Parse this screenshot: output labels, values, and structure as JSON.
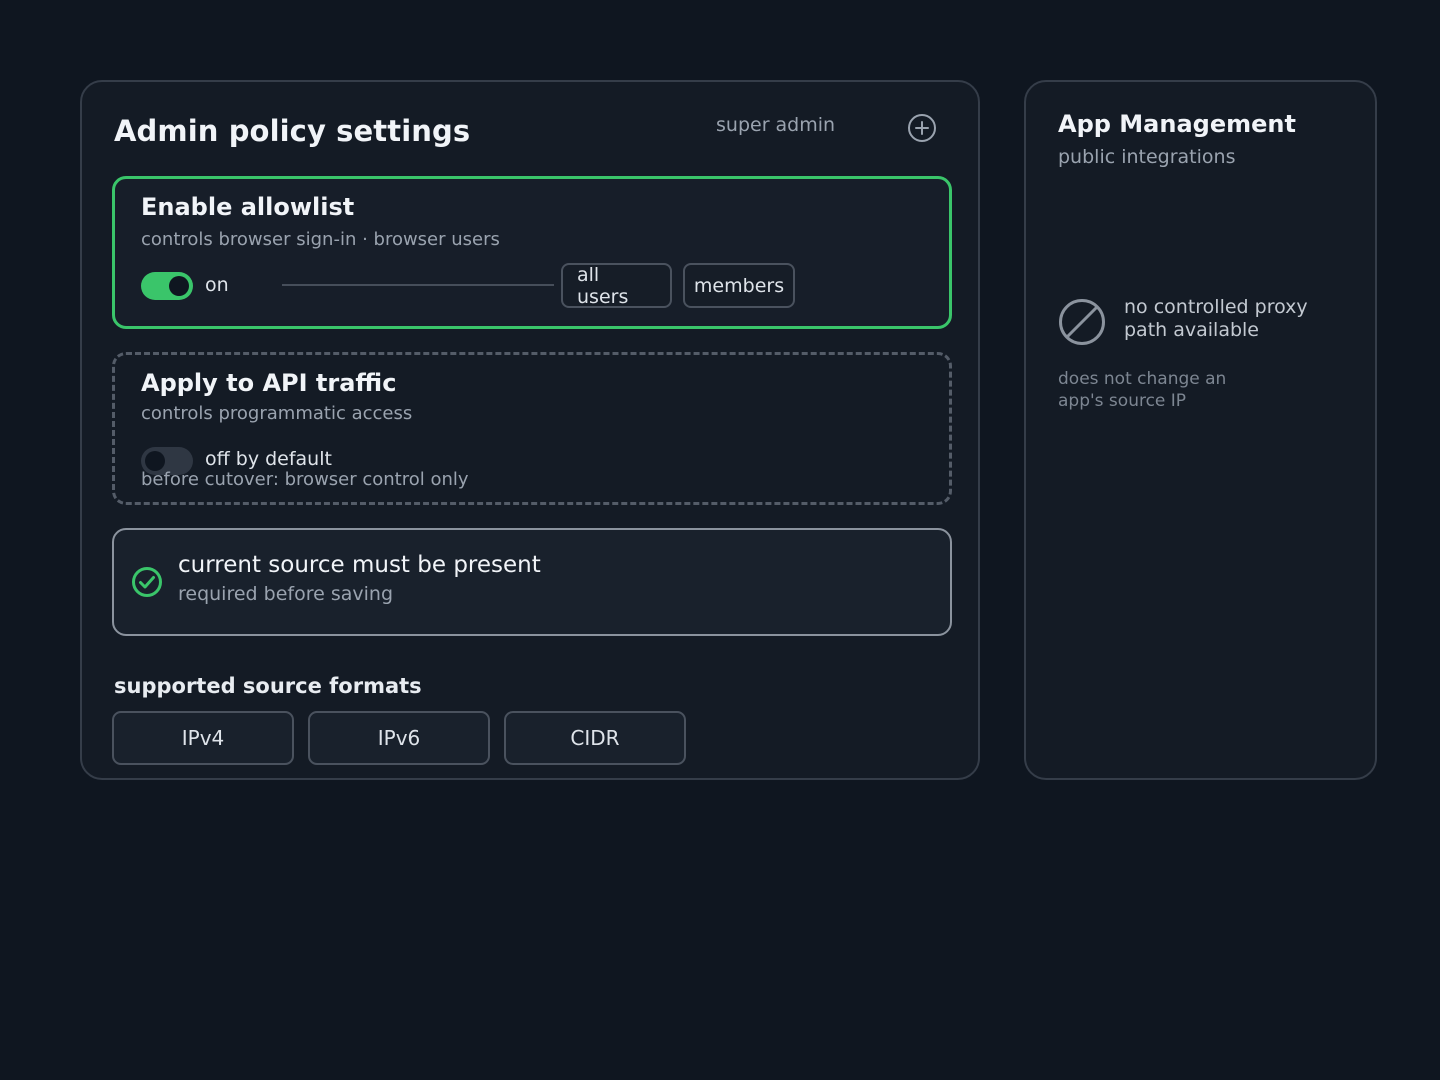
{
  "main": {
    "title": "Admin policy settings",
    "role": "super admin",
    "add_icon": "plus-circle-icon",
    "allowlist": {
      "title": "Enable allowlist",
      "subtitle": "controls browser sign-in · browser users",
      "toggle_state": "on",
      "toggle_label": "on",
      "chips": [
        "all users",
        "members"
      ],
      "accent_color": "#3ac56a"
    },
    "api_traffic": {
      "title": "Apply to API traffic",
      "subtitle": "controls programmatic access",
      "toggle_state": "off",
      "toggle_label": "off by default",
      "note": "before cutover: browser control only"
    },
    "source_check": {
      "icon": "check-circle-icon",
      "title": "current source must be present",
      "subtitle": "required before saving"
    },
    "formats": {
      "label": "supported source formats",
      "items": [
        "IPv4",
        "IPv6",
        "CIDR"
      ]
    }
  },
  "side": {
    "title": "App Management",
    "subtitle": "public integrations",
    "status_icon": "ban-icon",
    "status_line1": "no controlled proxy",
    "status_line2": "path available",
    "hint_line1": "does not change an",
    "hint_line2": "app's source IP"
  }
}
